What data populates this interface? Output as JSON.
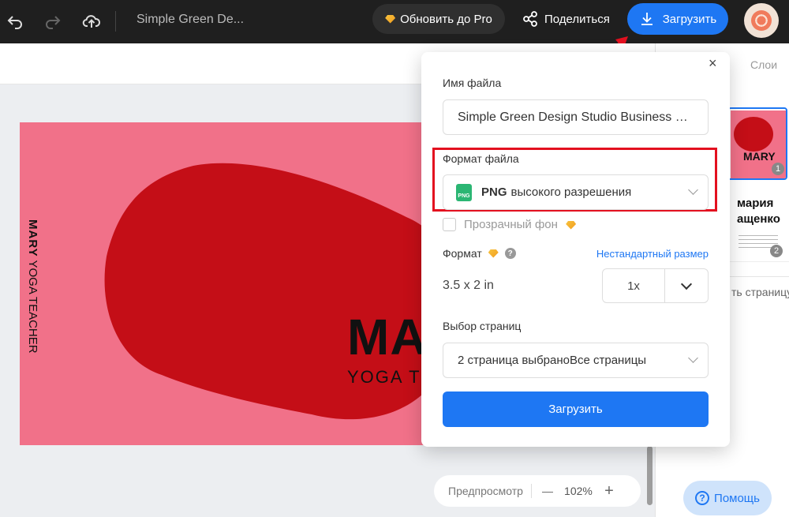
{
  "topbar": {
    "doc_title": "Simple Green De...",
    "upgrade_label": "Обновить до Pro",
    "share_label": "Поделиться",
    "download_label": "Загрузить"
  },
  "canvas": {
    "side_name": "MARY",
    "side_role": " YOGA TEACHER",
    "big_text": "MAR",
    "sub_text": "YOGA TE"
  },
  "zoom": {
    "preview_label": "Предпросмотр",
    "minus": "—",
    "value": "102%",
    "plus": "+"
  },
  "right_panel": {
    "layers_tab": "Слои",
    "thumb1_title": "MARY",
    "thumb1_number": "1",
    "thumb2_name": "мария\nащенко",
    "thumb2_number": "2",
    "add_page": "ть страницу",
    "help_label": "Помощь"
  },
  "dialog": {
    "close": "×",
    "filename_label": "Имя файла",
    "filename_value": "Simple Green Design Studio Business Card",
    "format_label": "Формат файла",
    "format_badge": "PNG",
    "format_value_bold": "PNG",
    "format_value_rest": "высокого разрешения",
    "transparent_label": "Прозрачный фон",
    "size_label": "Формат",
    "custom_size_link": "Нестандартный размер",
    "size_value": "3.5 x 2 in",
    "scale_value": "1x",
    "pages_label": "Выбор страниц",
    "pages_value": "2 страница выбраноВсе страницы",
    "submit_label": "Загрузить"
  },
  "colors": {
    "accent": "#1e77f3",
    "card_bg": "#f17189",
    "blob": "#c40e17",
    "highlight": "#e3101f"
  }
}
